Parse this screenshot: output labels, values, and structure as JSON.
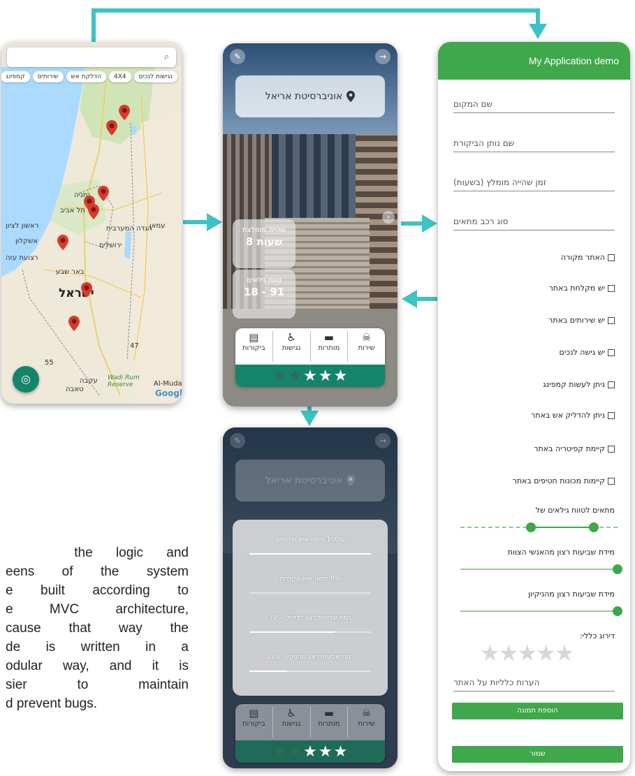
{
  "colors": {
    "connector": "#3ec3c4",
    "app_bar": "#3ea84b",
    "accent_teal": "#14846b"
  },
  "map_screen": {
    "search_icon": "search-icon",
    "filter_chips": [
      "נגישות לנכים",
      "4X4",
      "הדלקת אש",
      "שירותים",
      "קמפינג"
    ],
    "labels": {
      "israel": "ישראל",
      "tel_aviv": "תל אביב",
      "jerusalem": "ירושלים",
      "netanya": "נתניה",
      "ashkelon": "אשקלון",
      "beersheba": "באר שבע",
      "gaza": "רצועת עזה",
      "rishon": "ראשון לציון",
      "amman": "עמאן",
      "west_bank": "הגדה המערבית",
      "wadi_rum": "Wadi Rum Reserve",
      "aqaba": "עקבה",
      "taba": "טאבה",
      "al_mudaw": "Al-Mudaw",
      "google": "Google",
      "num_55": "55",
      "num_47": "47"
    },
    "fab_icon": "my-location-icon"
  },
  "site_screen": {
    "place_name": "אוניברסיטת אריאל",
    "stay_label": "שהייה מומלצת",
    "stay_value": "8 שעות",
    "age_label": "טווח גילאים",
    "age_value": "18 - 91",
    "features": [
      {
        "label": "שירות",
        "icon": "cleaning-icon"
      },
      {
        "label": "מותרות",
        "icon": "couch-icon"
      },
      {
        "label": "נגישות",
        "icon": "wheelchair-icon"
      },
      {
        "label": "ביקורות",
        "icon": "comment-icon"
      }
    ],
    "rating": {
      "filled": 3,
      "total": 5
    }
  },
  "stats_screen": {
    "place_name": "אוניברסיטת אריאל",
    "stats": [
      {
        "label": "100% סימנו שיש שירותים",
        "value": 1.0
      },
      {
        "label": "0% סימנו שיש מקלחת",
        "value": 0.0
      },
      {
        "label": "רמת שביעות רצון כללית: 70%",
        "value": 0.7
      },
      {
        "label": "רמת שביעות רצון מהניקיון: 31%",
        "value": 0.31
      }
    ],
    "features": [
      {
        "label": "שירות"
      },
      {
        "label": "מותרות"
      },
      {
        "label": "נגישות"
      },
      {
        "label": "ביקורות"
      }
    ]
  },
  "form_screen": {
    "title": "My Application demo",
    "fields": [
      "שם המקום",
      "שם נותן הביקורת",
      "זמן שהייה מומלץ (בשעות)",
      "סוג רכב מתאים"
    ],
    "checkboxes": [
      "האתר מקורה",
      "יש מקלחת באתר",
      "יש שירותים באתר",
      "יש גישה לנכים",
      "ניתן לעשות קמפינג",
      "ניתן להדליק אש באתר",
      "קיימת קפיטריה באתר",
      "קיימות מכונות חטיפים באתר"
    ],
    "age_range_label": "מתאים לטווח גילאים של",
    "age_range": [
      0.45,
      0.85
    ],
    "team_label": "מידת שביעות רצון מהאנשי הצוות",
    "team_value": 1.0,
    "clean_label": "מידת שביעות רצון מהניקיון",
    "clean_value": 1.0,
    "overall_label": "דירוג כללי:",
    "overall_rating": {
      "filled": 0,
      "total": 5
    },
    "comments_placeholder": "הערות כלליות על האתר",
    "add_image_button": "הוספת תמונה",
    "save_button": "שמור"
  },
  "body_text": {
    "lines": [
      "the logic and",
      "eens of the system",
      "e built according to",
      "e MVC architecture,",
      "cause that way the",
      "de is written in a",
      "odular way, and it is",
      "sier to maintain",
      "d prevent bugs."
    ]
  }
}
